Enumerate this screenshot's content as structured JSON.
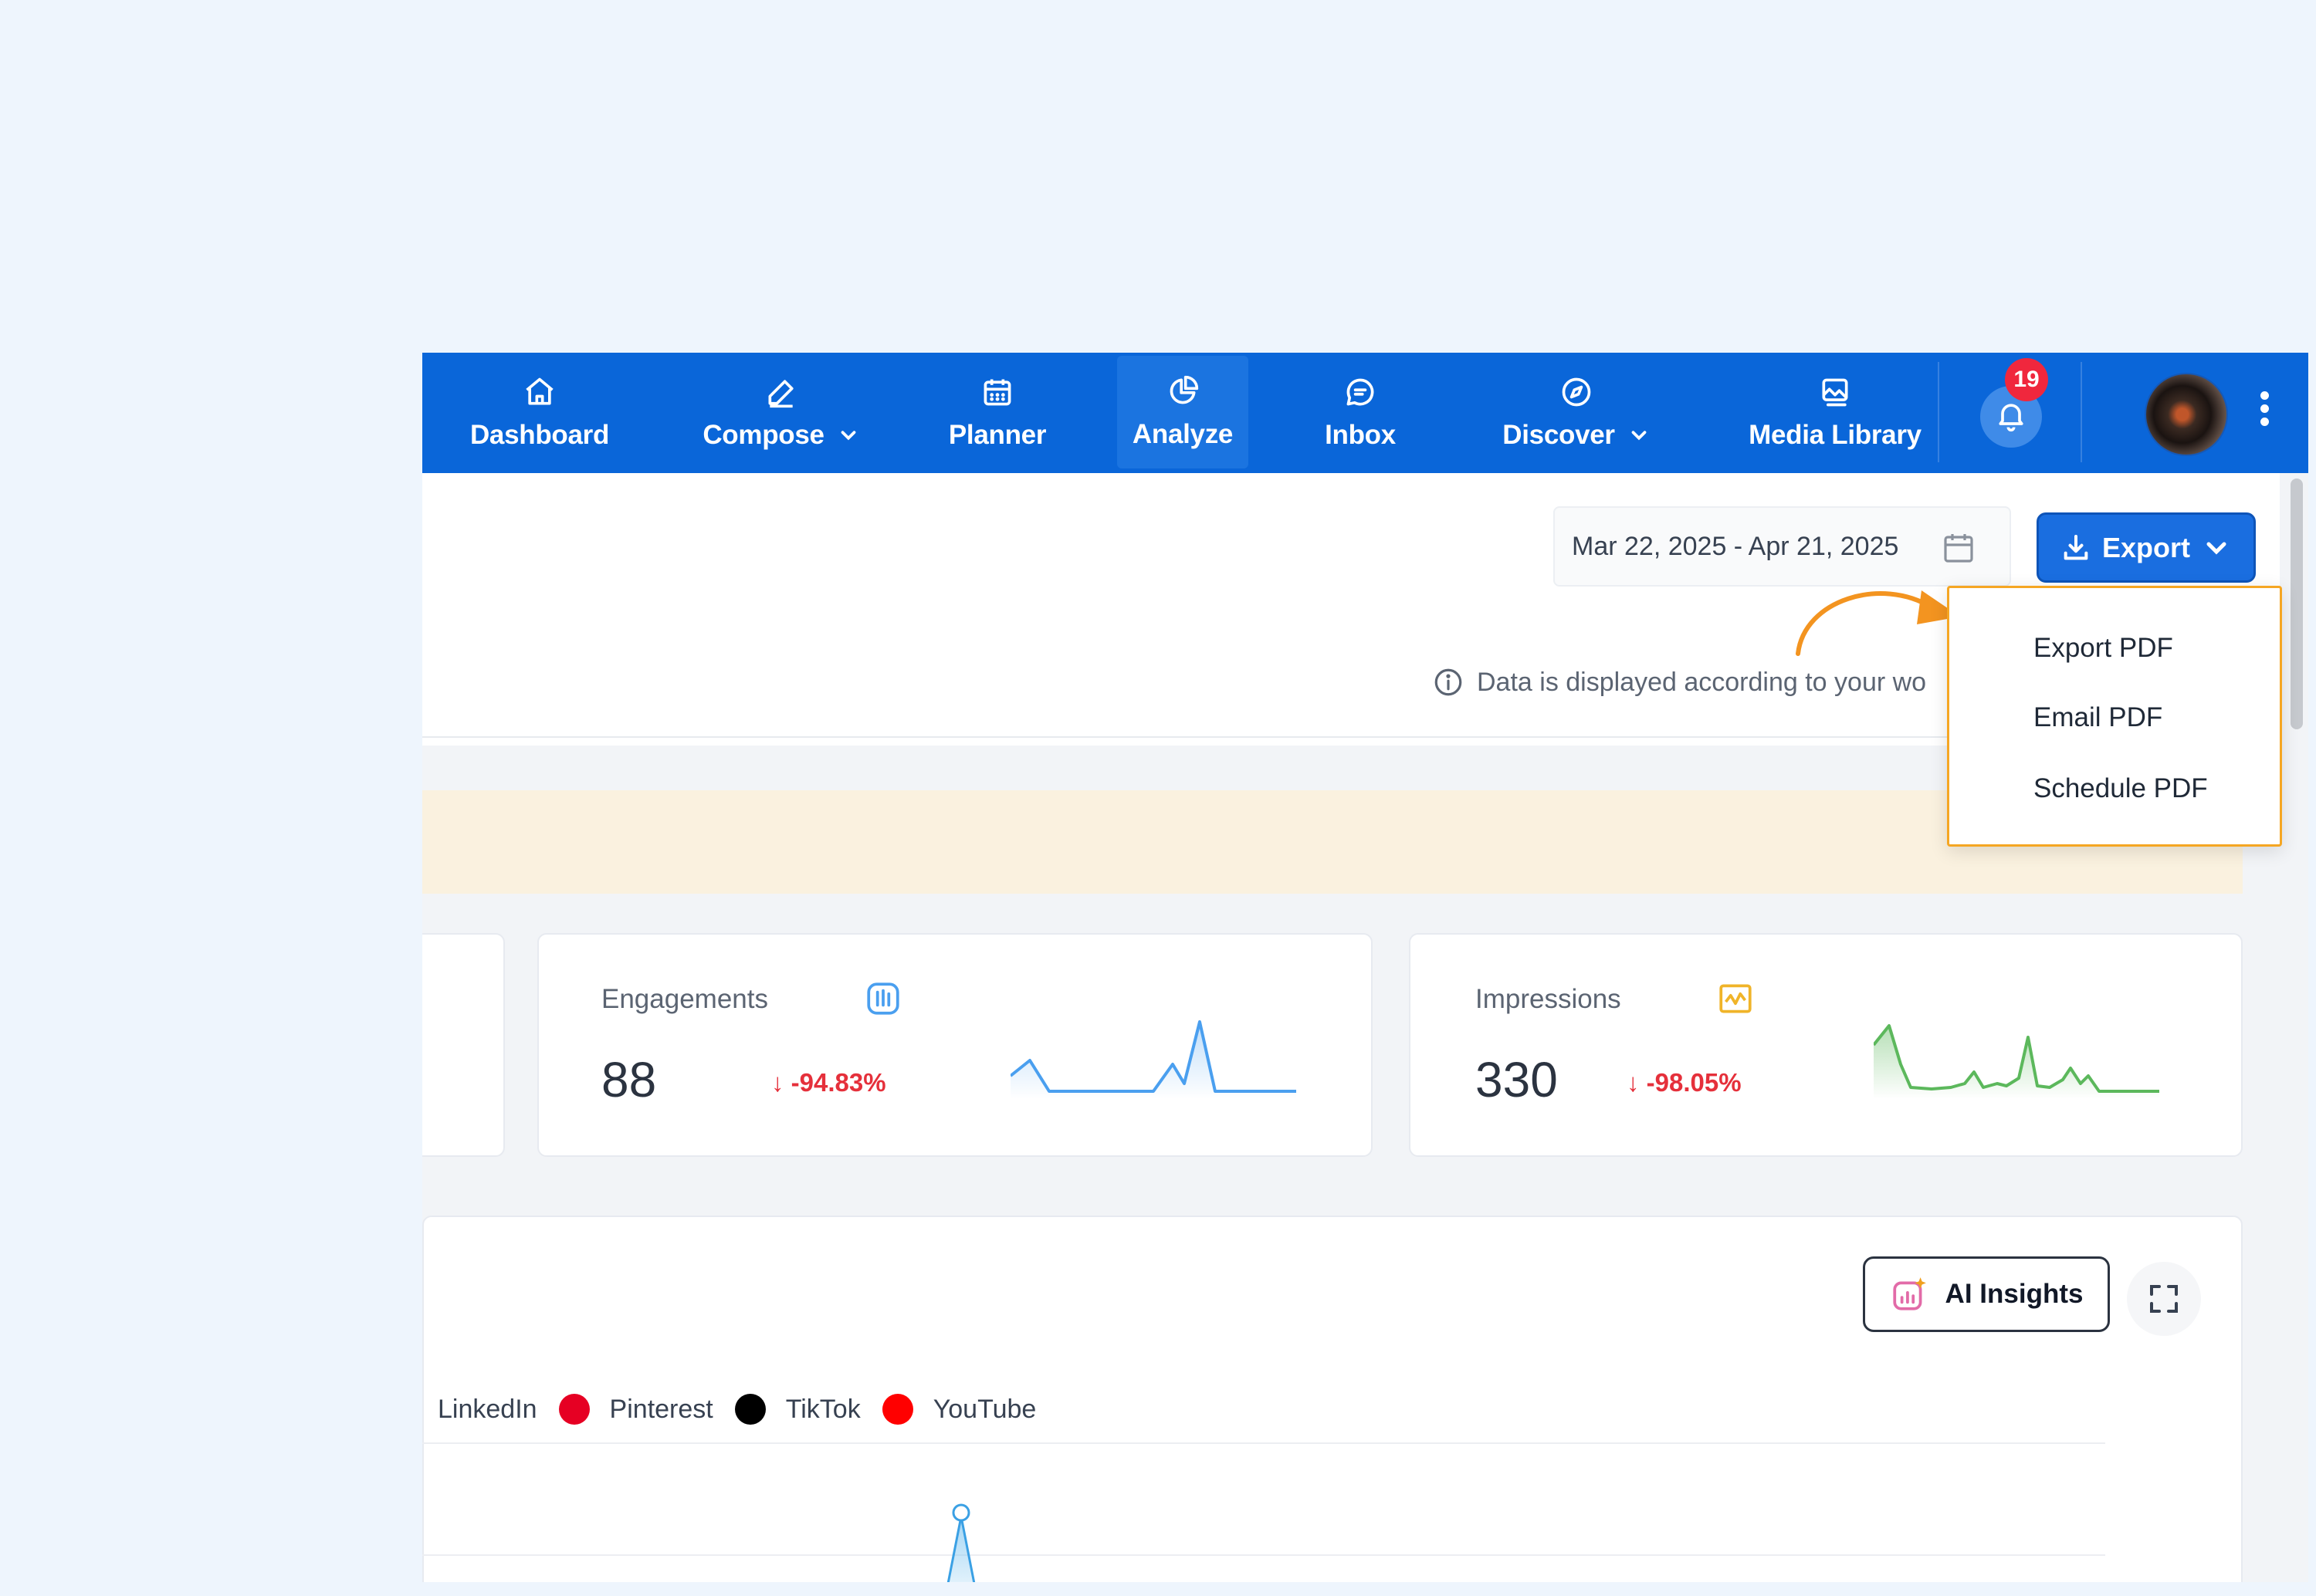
{
  "nav": {
    "items": [
      {
        "label": "Dashboard",
        "icon": "home-icon"
      },
      {
        "label": "Compose",
        "icon": "pencil-icon",
        "dropdown": true
      },
      {
        "label": "Planner",
        "icon": "calendar-icon"
      },
      {
        "label": "Analyze",
        "icon": "pie-chart-icon",
        "active": true
      },
      {
        "label": "Inbox",
        "icon": "chat-icon"
      },
      {
        "label": "Discover",
        "icon": "compass-icon",
        "dropdown": true
      },
      {
        "label": "Media Library",
        "icon": "image-icon"
      }
    ],
    "notifications_count": "19",
    "colors": {
      "bar": "#0a66d9",
      "active": "#1b74e0",
      "badge": "#f0273d"
    }
  },
  "toolbar": {
    "date_range": "Mar 22, 2025 - Apr 21, 2025",
    "export_label": "Export",
    "notice": "Data is displayed according to your wo"
  },
  "export_menu": {
    "options": [
      "Export PDF",
      "Email PDF",
      "Schedule PDF"
    ],
    "highlight_color": "#f5a623"
  },
  "metrics": [
    {
      "title": "Engagements",
      "value": "88",
      "change": "-94.83%",
      "trend": "down",
      "color": "#4a9fef"
    },
    {
      "title": "Impressions",
      "value": "330",
      "change": "-98.05%",
      "trend": "down",
      "color": "#5cb85c"
    }
  ],
  "chart_area": {
    "ai_button": "AI Insights",
    "legend": [
      {
        "name": "LinkedIn",
        "color": null
      },
      {
        "name": "Pinterest",
        "color": "#e60023"
      },
      {
        "name": "TikTok",
        "color": "#000000"
      },
      {
        "name": "YouTube",
        "color": "#ff0000"
      }
    ]
  }
}
